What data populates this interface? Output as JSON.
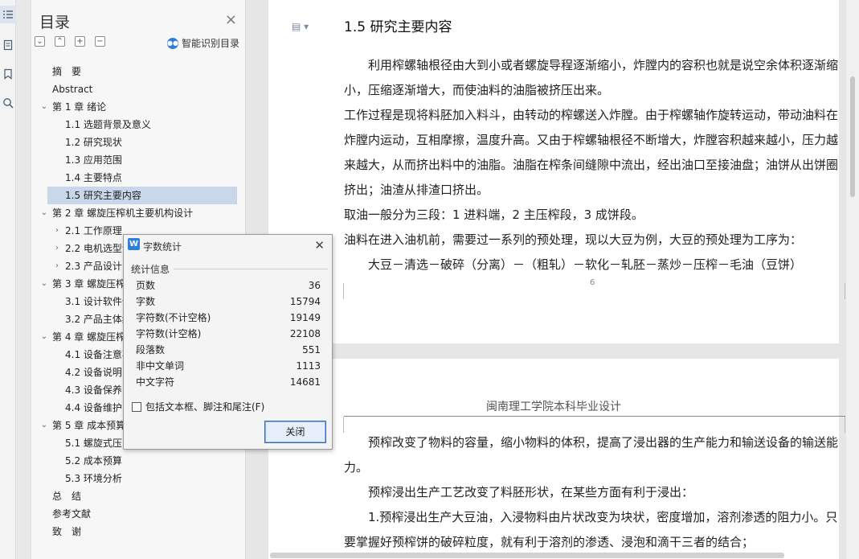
{
  "nav_icons": [
    "list-icon",
    "page-icon",
    "bookmark-icon",
    "search-icon"
  ],
  "toc": {
    "title": "目录",
    "close": "×",
    "smart_label": "智能识别目录",
    "items": [
      {
        "label": "摘　要",
        "level": 1,
        "arrow": ""
      },
      {
        "label": "Abstract",
        "level": 1,
        "arrow": ""
      },
      {
        "label": "第 1 章  绪论",
        "level": 1,
        "arrow": "v"
      },
      {
        "label": "1.1 选题背景及意义",
        "level": 2,
        "arrow": ""
      },
      {
        "label": "1.2 研究现状",
        "level": 2,
        "arrow": ""
      },
      {
        "label": "1.3 应用范围",
        "level": 2,
        "arrow": ""
      },
      {
        "label": "1.4 主要特点",
        "level": 2,
        "arrow": ""
      },
      {
        "label": "1.5  研究主要内容",
        "level": 2,
        "arrow": "",
        "selected": true
      },
      {
        "label": "第 2 章  螺旋压榨机主要机构设计",
        "level": 1,
        "arrow": "v"
      },
      {
        "label": "2.1 工作原理",
        "level": 2,
        "arrow": ">"
      },
      {
        "label": "2.2 电机选型计",
        "level": 2,
        "arrow": ">"
      },
      {
        "label": "2.3  产品设计",
        "level": 2,
        "arrow": ">"
      },
      {
        "label": "第 3 章  螺旋压榨",
        "level": 1,
        "arrow": "v"
      },
      {
        "label": "3.1 设计软件介",
        "level": 2,
        "arrow": ""
      },
      {
        "label": "3.2 产品主体结",
        "level": 2,
        "arrow": ""
      },
      {
        "label": "第 4 章  螺旋压榨",
        "level": 1,
        "arrow": "v"
      },
      {
        "label": "4.1  设备注意事",
        "level": 2,
        "arrow": ""
      },
      {
        "label": "4.2  设备说明",
        "level": 2,
        "arrow": ""
      },
      {
        "label": "4.3  设备保养",
        "level": 2,
        "arrow": ""
      },
      {
        "label": "4.4 设备维护",
        "level": 2,
        "arrow": ""
      },
      {
        "label": "第 5 章  成本预算",
        "level": 1,
        "arrow": "v"
      },
      {
        "label": "5.1  螺旋式压",
        "level": 2,
        "arrow": ""
      },
      {
        "label": "5.2  成本预算",
        "level": 2,
        "arrow": ""
      },
      {
        "label": "5.3  环境分析",
        "level": 2,
        "arrow": ""
      },
      {
        "label": "总　结",
        "level": 1,
        "arrow": ""
      },
      {
        "label": "参考文献",
        "level": 1,
        "arrow": ""
      },
      {
        "label": "致　谢",
        "level": 1,
        "arrow": ""
      }
    ]
  },
  "doc": {
    "section_title": "1.5  研究主要内容",
    "page1_paragraphs": [
      "　　利用榨螺轴根径由大到小或者螺旋导程逐渐缩小，炸膛内的容积也就是说空余体积逐渐缩小，压缩逐渐增大，而使油料的油脂被挤压出来。",
      "工作过程是现将料胚加入料斗，由转动的榨螺送入炸膛。由于榨螺轴作旋转运动，带动油料在炸膛内运动，互相摩擦，温度升高。又由于榨螺轴根径不断增大，炸膛容积越来越小，压力越来越大，从而挤出料中的油脂。油脂在榨条间缝隙中流出，经出油口至接油盘；油饼从出饼圈挤出；油渣从排渣口挤出。",
      "取油一般分为三段：1 进料端，2  主压榨段，3 成饼段。",
      "油料在进入油机前，需要过一系列的预处理，现以大豆为例，大豆的预处理为工序为：",
      "　　大豆－清选－破碎（分离）－（粗轧）－软化－轧胚－蒸炒－压榨－毛油（豆饼）"
    ],
    "page_number": "6",
    "page2_header": "闽南理工学院本科毕业设计",
    "page2_paragraphs": [
      "　　预榨改变了物料的容量，缩小物料的体积，提高了浸出器的生产能力和输送设备的输送能力。",
      "　　预榨浸出生产工艺改变了料胚形状，在某些方面有利于浸出：",
      "　　1.预榨浸出生产大豆油，入浸物料由片状改变为块状，密度增加，溶剂渗透的阻力小。只要掌握好预榨饼的破碎粒度，就有利于溶剂的渗透、浸泡和滴干三者的结合；"
    ]
  },
  "dialog": {
    "title": "字数统计",
    "icon_letter": "W",
    "group_label": "统计信息",
    "stats": [
      {
        "label": "页数",
        "value": "36"
      },
      {
        "label": "字数",
        "value": "15794"
      },
      {
        "label": "字符数(不计空格)",
        "value": "19149"
      },
      {
        "label": "字符数(计空格)",
        "value": "22108"
      },
      {
        "label": "段落数",
        "value": "551"
      },
      {
        "label": "非中文单词",
        "value": "1113"
      },
      {
        "label": "中文字符",
        "value": "14681"
      }
    ],
    "checkbox_label": "包括文本框、脚注和尾注(F)",
    "checkbox_checked": false,
    "close_button": "关闭"
  }
}
